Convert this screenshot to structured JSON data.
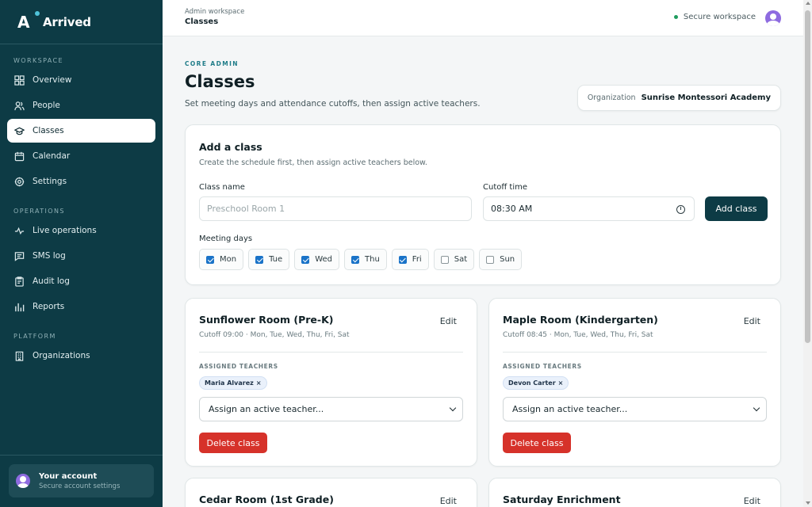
{
  "brand": {
    "logo": "A",
    "name": "Arrived"
  },
  "sidebar": {
    "sections": [
      {
        "title": "WORKSPACE",
        "items": [
          {
            "label": "Overview",
            "icon": "grid-icon"
          },
          {
            "label": "People",
            "icon": "people-icon"
          },
          {
            "label": "Classes",
            "icon": "graduation-cap-icon",
            "active": true
          },
          {
            "label": "Calendar",
            "icon": "calendar-icon"
          },
          {
            "label": "Settings",
            "icon": "gear-icon"
          }
        ]
      },
      {
        "title": "OPERATIONS",
        "items": [
          {
            "label": "Live operations",
            "icon": "activity-icon"
          },
          {
            "label": "SMS log",
            "icon": "message-icon"
          },
          {
            "label": "Audit log",
            "icon": "clipboard-icon"
          },
          {
            "label": "Reports",
            "icon": "bar-chart-icon"
          }
        ]
      },
      {
        "title": "PLATFORM",
        "items": [
          {
            "label": "Organizations",
            "icon": "building-icon"
          }
        ]
      }
    ],
    "account": {
      "title": "Your account",
      "subtitle": "Secure account settings"
    }
  },
  "topbar": {
    "crumb_parent": "Admin workspace",
    "crumb_current": "Classes",
    "status": "Secure workspace",
    "status_color": "#1f9c5e"
  },
  "page": {
    "eyebrow": "CORE ADMIN",
    "title": "Classes",
    "subtitle": "Set meeting days and attendance cutoffs, then assign active teachers.",
    "org_label": "Organization",
    "org_value": "Sunrise Montessori Academy"
  },
  "add_class": {
    "title": "Add a class",
    "subtitle": "Create the schedule first, then assign active teachers below.",
    "name_label": "Class name",
    "name_placeholder": "Preschool Room 1",
    "cutoff_label": "Cutoff time",
    "cutoff_value": "08:30 AM",
    "submit_label": "Add class",
    "days_label": "Meeting days",
    "days": [
      {
        "label": "Mon",
        "checked": true
      },
      {
        "label": "Tue",
        "checked": true
      },
      {
        "label": "Wed",
        "checked": true
      },
      {
        "label": "Thu",
        "checked": true
      },
      {
        "label": "Fri",
        "checked": true
      },
      {
        "label": "Sat",
        "checked": false
      },
      {
        "label": "Sun",
        "checked": false
      }
    ]
  },
  "classes": [
    {
      "name": "Sunflower Room (Pre-K)",
      "edit": "Edit",
      "meta": "Cutoff 09:00 · Mon, Tue, Wed, Thu, Fri, Sat",
      "assigned_label": "ASSIGNED TEACHERS",
      "teachers": [
        "Maria Alvarez"
      ],
      "select": "Assign an active teacher...",
      "delete": "Delete class"
    },
    {
      "name": "Maple Room (Kindergarten)",
      "edit": "Edit",
      "meta": "Cutoff 08:45 · Mon, Tue, Wed, Thu, Fri, Sat",
      "assigned_label": "ASSIGNED TEACHERS",
      "teachers": [
        "Devon Carter"
      ],
      "select": "Assign an active teacher...",
      "delete": "Delete class"
    },
    {
      "name": "Cedar Room (1st Grade)",
      "edit": "Edit"
    },
    {
      "name": "Saturday Enrichment",
      "edit": "Edit"
    }
  ],
  "colors": {
    "sidebar": "#0d3b45",
    "accent": "#1f7c88",
    "danger": "#d6322a",
    "checkbox": "#1a73c8"
  }
}
